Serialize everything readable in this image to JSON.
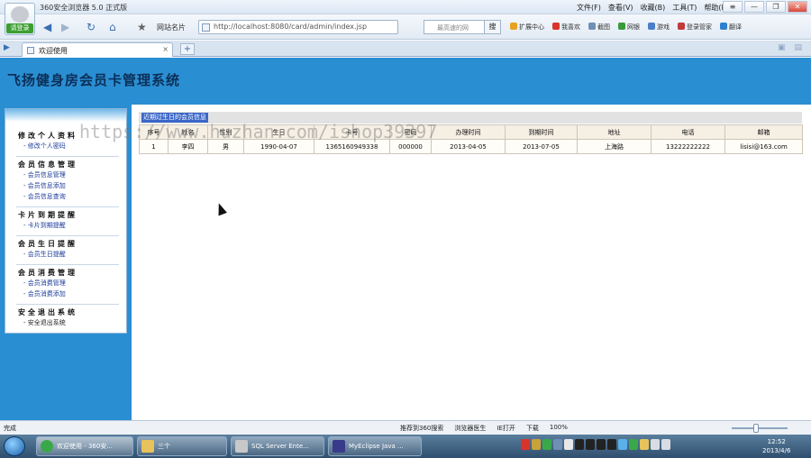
{
  "browser": {
    "app_title": "360安全浏览器 5.0 正式版",
    "logo_label": "请登录",
    "menu": [
      "文件(F)",
      "查看(V)",
      "收藏(B)",
      "工具(T)",
      "帮助(H)"
    ],
    "window_controls": [
      "≡",
      "—",
      "❐",
      "✕"
    ],
    "favorites_label": "网站名片",
    "address": "http://localhost:8080/card/admin/index.jsp",
    "search_placeholder": "最高速的网",
    "search_button": "搜",
    "toolbar": [
      "扩展中心",
      "我喜欢",
      "截图",
      "网银",
      "游戏",
      "登录管家",
      "翻译"
    ],
    "tab_label": "欢迎使用",
    "tab_close": "×",
    "new_tab": "+",
    "nav": {
      "back": "◀",
      "forward": "▶",
      "refresh": "↻",
      "home": "⌂",
      "favorite": "★"
    }
  },
  "page": {
    "site_title": "飞扬健身房会员卡管理系统",
    "notice": "近期过生日的会员信息",
    "watermark": "https://www.huzhan.com/ishop39397"
  },
  "menu_groups": [
    {
      "title": "修改个人资料",
      "items": [
        "修改个人密码"
      ]
    },
    {
      "title": "会员信息管理",
      "items": [
        "会员信息管理",
        "会员信息添加",
        "会员信息查询"
      ]
    },
    {
      "title": "卡片到期提醒",
      "items": [
        "卡片到期提醒"
      ]
    },
    {
      "title": "会员生日提醒",
      "items": [
        "会员生日提醒"
      ]
    },
    {
      "title": "会员消费管理",
      "items": [
        "会员消费管理",
        "会员消费添加"
      ]
    },
    {
      "title": "安全退出系统",
      "items": [
        "安全退出系统"
      ]
    }
  ],
  "table": {
    "columns": [
      "序号",
      "姓名",
      "性别",
      "生日",
      "卡号",
      "密码",
      "办理时间",
      "到期时间",
      "地址",
      "电话",
      "邮箱"
    ],
    "rows": [
      [
        "1",
        "李四",
        "男",
        "1990-04-07",
        "13651609493​38",
        "000000",
        "2013-04-05",
        "2013-07-05",
        "上海路",
        "13222222222",
        "lisisi@163.com"
      ]
    ]
  },
  "statusbar": {
    "status": "完成",
    "items": [
      "推荐到360搜索",
      "浏览器医生",
      "IE打开",
      "下载",
      "100%"
    ]
  },
  "taskbar": {
    "tasks": [
      "欢迎使用 - 360安...",
      "三个",
      "SQL Server Ente...",
      "MyEclipse Java ..."
    ],
    "time": "12:52",
    "date": "2013/4/6"
  },
  "colors": {
    "header_blue": "#2a8ed2",
    "title_text": "#0c2f57",
    "link_blue": "#1a3a9a",
    "table_header": "#f5efe4"
  }
}
